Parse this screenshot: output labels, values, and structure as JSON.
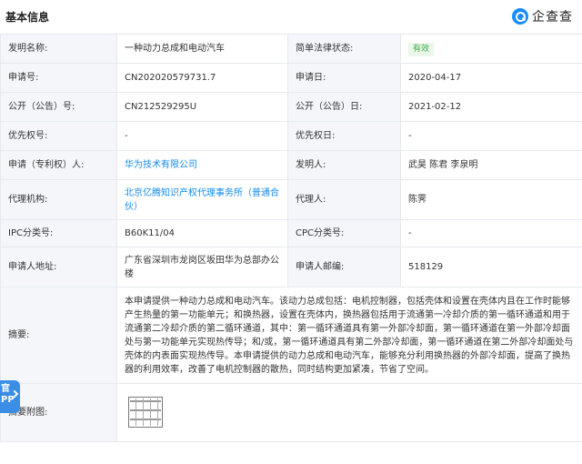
{
  "header": {
    "title": "基本信息",
    "brand": "企查查",
    "brand_icon": "qcc-logo-icon",
    "brand_color": "#1a8cff"
  },
  "rows": {
    "invention_name": {
      "label": "发明名称:",
      "value": "一种动力总成和电动汽车"
    },
    "legal_status": {
      "label": "简单法律状态:",
      "value": "有效"
    },
    "application_no": {
      "label": "申请号:",
      "value": "CN202020579731.7"
    },
    "application_date": {
      "label": "申请日:",
      "value": "2020-04-17"
    },
    "publication_no": {
      "label": "公开（公告）号:",
      "value": "CN212529295U"
    },
    "publication_date": {
      "label": "公开（公告）日:",
      "value": "2021-02-12"
    },
    "priority_no": {
      "label": "优先权号:",
      "value": "-"
    },
    "priority_date": {
      "label": "优先权日:",
      "value": "-"
    },
    "applicant": {
      "label": "申请（专利权）人:",
      "value": "华为技术有限公司"
    },
    "inventor": {
      "label": "发明人:",
      "value": "武昊 陈君 李泉明"
    },
    "agency": {
      "label": "代理机构:",
      "value": "北京亿腾知识产权代理事务所（普通合伙）"
    },
    "agent": {
      "label": "代理人:",
      "value": "陈霁"
    },
    "ipc": {
      "label": "IPC分类号:",
      "value": "B60K11/04"
    },
    "cpc": {
      "label": "CPC分类号:",
      "value": "-"
    },
    "address": {
      "label": "申请人地址:",
      "value": "广东省深圳市龙岗区坂田华为总部办公楼"
    },
    "postcode": {
      "label": "申请人邮编:",
      "value": "518129"
    },
    "abstract": {
      "label": "摘要:",
      "value": "本申请提供一种动力总成和电动汽车。该动力总成包括：电机控制器，包括壳体和设置在壳体内且在工作时能够产生热量的第一功能单元；和换热器，设置在壳体内，换热器包括用于流通第一冷却介质的第一循环通道和用于流通第二冷却介质的第二循环通道，其中：第一循环通道具有第一外部冷却面，第一循环通道在第一外部冷却面处与第一功能单元实现热传导；和/或，第一循环通道具有第二外部冷却面，第一循环通道在第二外部冷却面处与壳体的内表面实现热传导。本申请提供的动力总成和电动汽车，能够充分利用换热器的外部冷却面，提高了换热器的利用效率，改善了电机控制器的散热，同时结构更加紧凑，节省了空间。"
    },
    "drawing": {
      "label": "摘要附图:"
    }
  },
  "side_tab": {
    "text": "官\nPP",
    "color": "#3a8ee6"
  },
  "colors": {
    "label_bg": "#f4f6fa",
    "border": "#e6e9ee",
    "link": "#128bed",
    "status_green": "#3fae49"
  }
}
